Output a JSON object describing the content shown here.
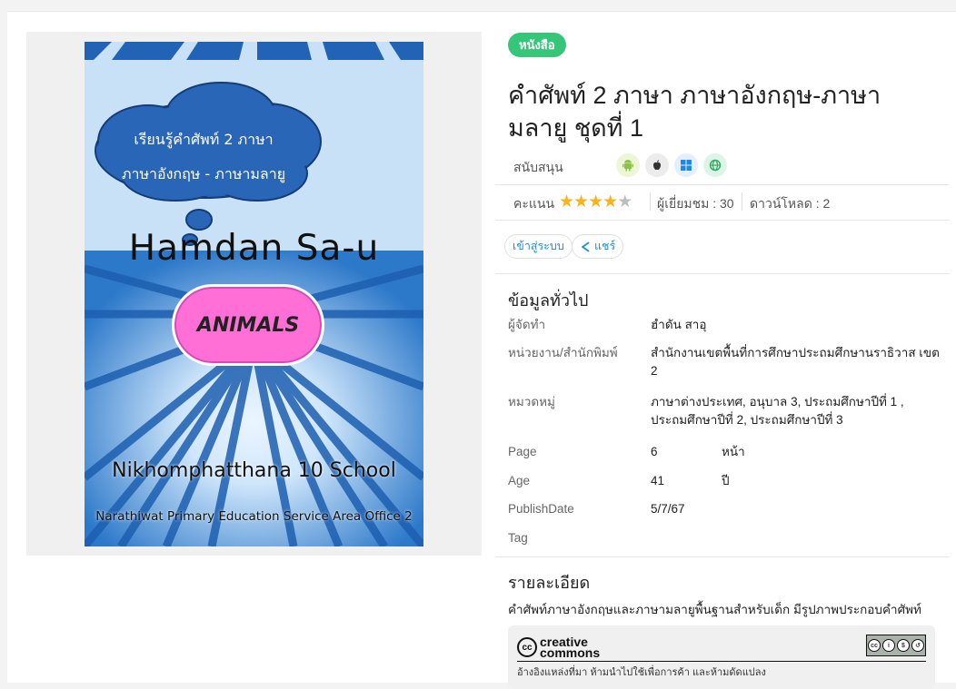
{
  "cover": {
    "cloud_line1": "เรียนรู้คำศัพท์  2  ภาษา",
    "cloud_line2": "ภาษาอังกฤษ  -  ภาษามลายู",
    "title": "Hamdan Sa-u",
    "pill": "ANIMALS",
    "school": "Nikhomphatthana 10 School",
    "office": "Narathiwat Primary Education Service Area Office 2"
  },
  "badge": "หนังสือ",
  "title": "คำศัพท์ 2 ภาษา ภาษาอังกฤษ-ภาษามลายู ชุดที่ 1",
  "support": {
    "label": "สนับสนุน",
    "platforms": [
      "android-icon",
      "apple-icon",
      "windows-icon",
      "web-icon"
    ]
  },
  "stats": {
    "rating_label": "คะแนน",
    "rating": 4,
    "rating_max": 5,
    "views": "ผู้เยี่ยมชม : 30",
    "downloads": "ดาวน์โหลด : 2"
  },
  "actions": {
    "login": "เข้าสู่ระบบ",
    "share": "แชร์"
  },
  "general": {
    "heading": "ข้อมูลทั่วไป",
    "author_label": "ผู้จัดทำ",
    "author": "ฮำดัน สาอุ",
    "publisher_label": "หน่วยงาน/สำนักพิมพ์",
    "publisher": "สำนักงานเขตพื้นที่การศึกษาประถมศึกษานราธิวาส เขต 2",
    "category_label": "หมวดหมู่",
    "category": "ภาษาต่างประเทศ, อนุบาล 3, ประถมศึกษาปีที่ 1 , ประถมศึกษาปีที่ 2, ประถมศึกษาปีที่ 3",
    "page_label": "Page",
    "page": "6",
    "page_unit": "หน้า",
    "age_label": "Age",
    "age": "41",
    "age_unit": "ปี",
    "publish_label": "PublishDate",
    "publish": "5/7/67",
    "tag_label": "Tag"
  },
  "detail": {
    "heading": "รายละเอียด",
    "text": "คำศัพท์ภาษาอังกฤษและภาษามลายูพื้นฐานสำหรับเด็ก มีรูปภาพประกอบคำศัพท์"
  },
  "license": {
    "logo_line1": "creative",
    "logo_line2": "commons",
    "text": "อ้างอิงแหล่งที่มา ห้ามนำไปใช้เพื่อการค้า และห้ามดัดแปลง"
  },
  "colors": {
    "badge": "#35c67a",
    "star_on": "#f5b321",
    "link": "#1a8fd6"
  }
}
